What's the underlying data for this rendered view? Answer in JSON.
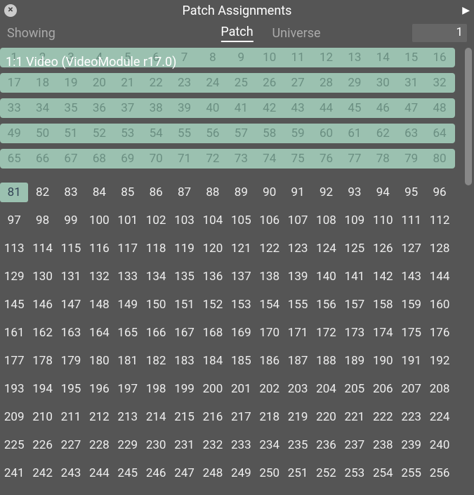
{
  "title": "Patch Assignments",
  "subheader": {
    "showing": "Showing",
    "patch": "Patch",
    "universe_label": "Universe",
    "universe_value": "1"
  },
  "overlay_label": "1:1 Video (VideoModule r17.0)",
  "patched_range_start": 1,
  "patched_range_end": 80,
  "selected_slot": 81,
  "visible_cols": 16,
  "visible_rows_patched": 5,
  "unpatched_start": 81,
  "unpatched_end": 256
}
